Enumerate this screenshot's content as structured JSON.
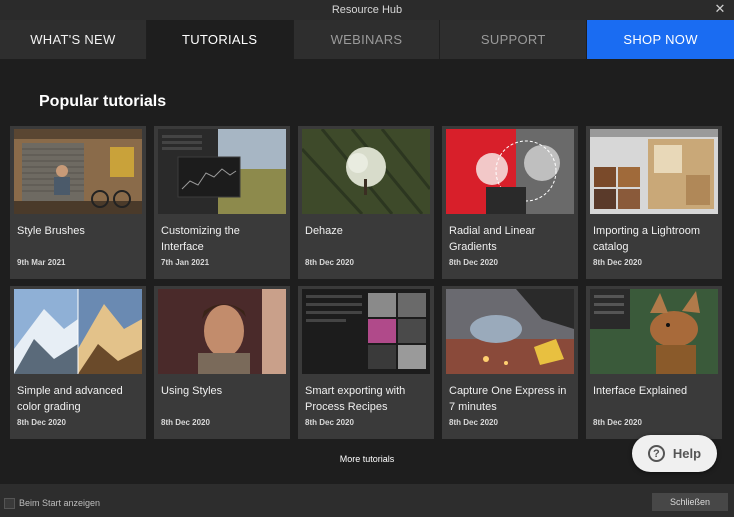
{
  "window": {
    "title": "Resource Hub",
    "close_glyph": "✕"
  },
  "tabs": [
    {
      "label": "WHAT'S NEW"
    },
    {
      "label": "TUTORIALS"
    },
    {
      "label": "WEBINARS"
    },
    {
      "label": "SUPPORT"
    },
    {
      "label": "SHOP NOW"
    }
  ],
  "active_tab": "TUTORIALS",
  "accent_color": "#1a6cf2",
  "main": {
    "heading": "Popular tutorials",
    "more_link": "More tutorials"
  },
  "tutorials": [
    {
      "title": "Style Brushes",
      "date": "9th Mar 2021"
    },
    {
      "title": "Customizing the Interface",
      "date": "7th Jan 2021"
    },
    {
      "title": "Dehaze",
      "date": "8th Dec 2020"
    },
    {
      "title": "Radial and Linear Gradients",
      "date": "8th Dec 2020"
    },
    {
      "title": "Importing a Lightroom catalog",
      "date": "8th Dec 2020"
    },
    {
      "title": "Simple and advanced color grading",
      "date": "8th Dec 2020"
    },
    {
      "title": "Using Styles",
      "date": "8th Dec 2020"
    },
    {
      "title": "Smart exporting with Process Recipes",
      "date": "8th Dec 2020"
    },
    {
      "title": "Capture One Express in 7 minutes",
      "date": "8th Dec 2020"
    },
    {
      "title": "Interface Explained",
      "date": "8th Dec 2020"
    }
  ],
  "help": {
    "label": "Help",
    "icon": "question-circle-icon"
  },
  "footer": {
    "startup_checkbox_label": "Beim Start anzeigen",
    "close_button": "Schließen"
  }
}
